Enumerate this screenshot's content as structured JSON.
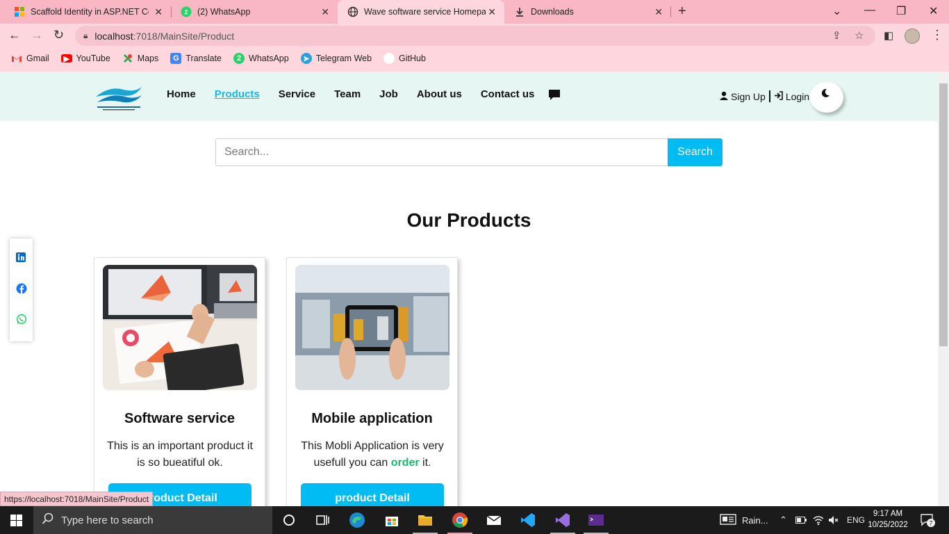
{
  "browser": {
    "tabs": [
      {
        "title": "Scaffold Identity in ASP.NET Core",
        "icon": "microsoft-icon"
      },
      {
        "title": "(2) WhatsApp",
        "icon": "whatsapp-icon"
      },
      {
        "title": "Wave software service Homepage",
        "icon": "globe-icon"
      },
      {
        "title": "Downloads",
        "icon": "download-icon"
      }
    ],
    "url_host": "localhost",
    "url_path": ":7018/MainSite/Product",
    "bookmarks": [
      {
        "label": "Gmail",
        "icon": "gmail-icon",
        "color": "#ea4335"
      },
      {
        "label": "YouTube",
        "icon": "youtube-icon",
        "color": "#ff0000"
      },
      {
        "label": "Maps",
        "icon": "maps-icon",
        "color": "#34a853"
      },
      {
        "label": "Translate",
        "icon": "translate-icon",
        "color": "#4285f4"
      },
      {
        "label": "WhatsApp",
        "icon": "whatsapp-icon",
        "color": "#25d366"
      },
      {
        "label": "Telegram Web",
        "icon": "telegram-icon",
        "color": "#2aa1da"
      },
      {
        "label": "GitHub",
        "icon": "github-icon",
        "color": "#ffffff"
      }
    ],
    "status_url": "https://localhost:7018/MainSite/Product"
  },
  "site": {
    "nav": {
      "items": [
        "Home",
        "Products",
        "Service",
        "Team",
        "Job",
        "About us",
        "Contact us"
      ],
      "active": "Products",
      "signup": "Sign Up",
      "login": "Login"
    },
    "search": {
      "placeholder": "Search...",
      "button": "Search"
    },
    "heading": "Our Products",
    "products": [
      {
        "title": "Software service",
        "description": "This is an important product it is so bueatiful ok.",
        "button": "product Detail"
      },
      {
        "title": "Mobile application",
        "description_pre": "This Mobli Application is very usefull you can ",
        "description_highlight": "order",
        "description_post": " it.",
        "button": "product Detail"
      }
    ],
    "colors": {
      "accent": "#00bcf2",
      "navbar_bg": "#e6f7f3",
      "highlight": "#1cba6e"
    }
  },
  "taskbar": {
    "search_placeholder": "Type here to search",
    "weather": "Rain...",
    "language": "ENG",
    "time": "9:17 AM",
    "date": "10/25/2022",
    "notifications": "7"
  }
}
